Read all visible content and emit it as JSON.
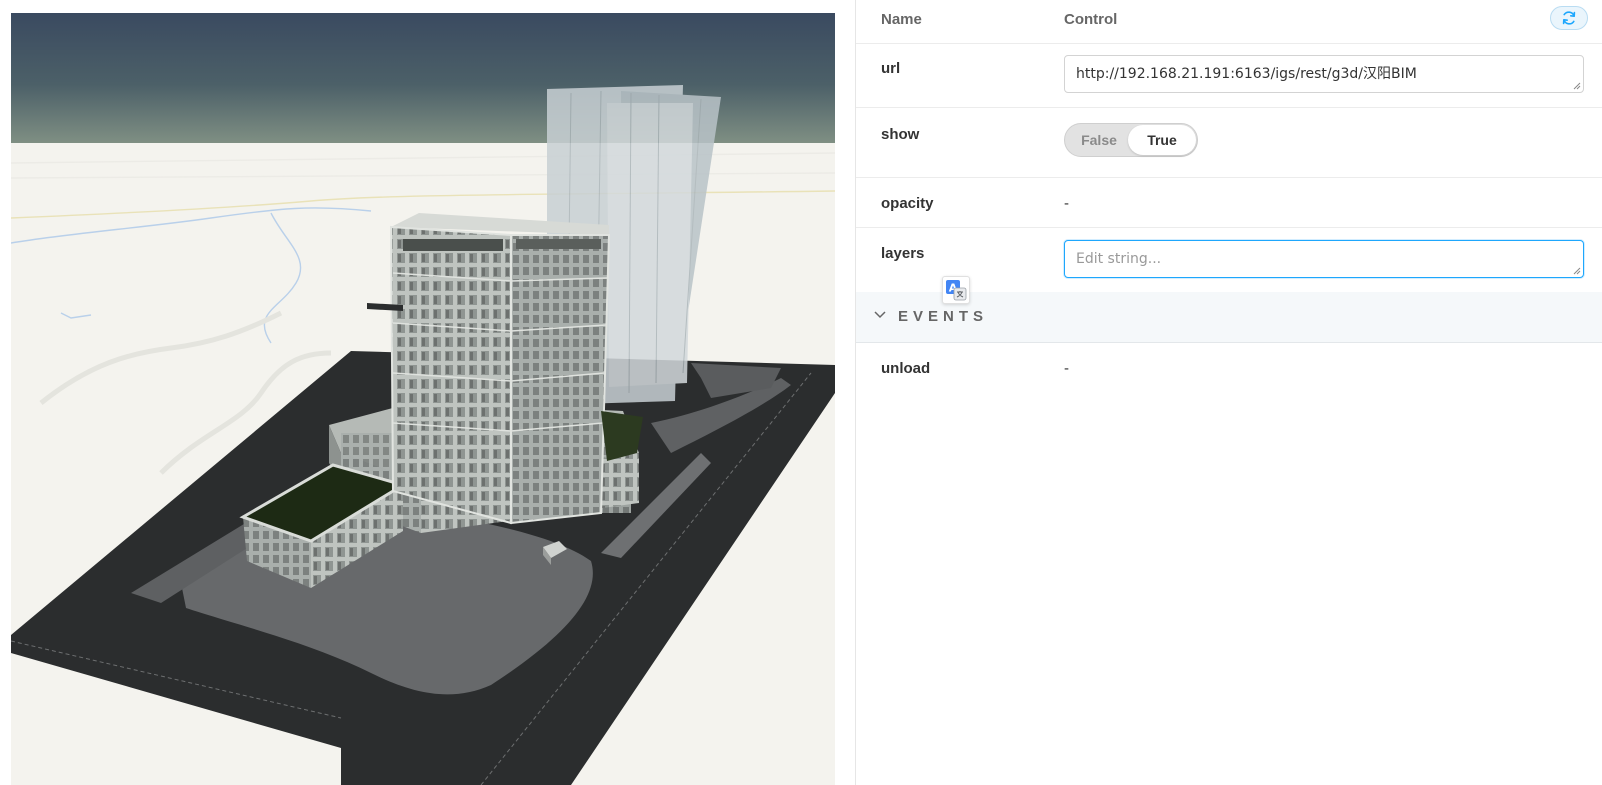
{
  "header": {
    "name_col": "Name",
    "control_col": "Control",
    "reset_icon": "sync-icon"
  },
  "rows": {
    "url": {
      "name": "url",
      "value": "http://192.168.21.191:6163/igs/rest/g3d/汉阳BIM"
    },
    "show": {
      "name": "show",
      "off_label": "False",
      "on_label": "True",
      "value": true
    },
    "opacity": {
      "name": "opacity",
      "value": "-"
    },
    "layers": {
      "name": "layers",
      "value": "",
      "placeholder": "Edit string..."
    }
  },
  "events": {
    "title": "EVENTS",
    "rows": {
      "unload": {
        "name": "unload",
        "value": "-"
      }
    }
  },
  "overlay": {
    "translate_icon": "google-translate-icon"
  },
  "colors": {
    "accent": "#1ea7fd",
    "sky_top": "#3a4a60",
    "ground": "#f4f3ee",
    "road": "#2b2d2e"
  }
}
